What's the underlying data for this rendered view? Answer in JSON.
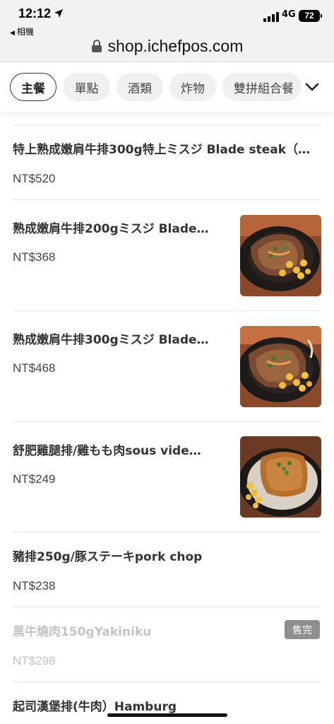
{
  "status_bar": {
    "time": "12:12",
    "back_app": "相機",
    "network": "4G",
    "battery": "72"
  },
  "browser": {
    "url": "shop.ichefpos.com"
  },
  "tabs": [
    {
      "label": "主餐",
      "active": true
    },
    {
      "label": "單點",
      "active": false
    },
    {
      "label": "酒類",
      "active": false
    },
    {
      "label": "炸物",
      "active": false
    },
    {
      "label": "雙拼組合餐",
      "active": false
    }
  ],
  "menu": {
    "items": [
      {
        "name": "特上熟成嫩肩牛排300g特上ミスジ Blade steak（…",
        "price": "NT$520",
        "image": null,
        "sold_out": false
      },
      {
        "name": "熟成嫩肩牛排200gミスジ Blade…",
        "price": "NT$368",
        "image": "steak-photo",
        "sold_out": false
      },
      {
        "name": "熟成嫩肩牛排300gミスジ Blade…",
        "price": "NT$468",
        "image": "steak-photo",
        "sold_out": false
      },
      {
        "name": "舒肥雞腿排/雞もも肉sous vide…",
        "price": "NT$249",
        "image": "chicken-photo",
        "sold_out": false
      },
      {
        "name": "豬排250g/豚ステーキpork chop",
        "price": "NT$238",
        "image": null,
        "sold_out": false
      },
      {
        "name": "黑牛燒肉150gYakiniku",
        "price": "NT$298",
        "image": null,
        "sold_out": true,
        "badge": "售完"
      },
      {
        "name": "起司漢堡排(牛肉）Hamburg",
        "price": "",
        "image": null,
        "sold_out": false
      }
    ]
  },
  "colors": {
    "sold_badge": "#8f8f8f",
    "text": "#333333",
    "muted": "#c4c4c4"
  }
}
